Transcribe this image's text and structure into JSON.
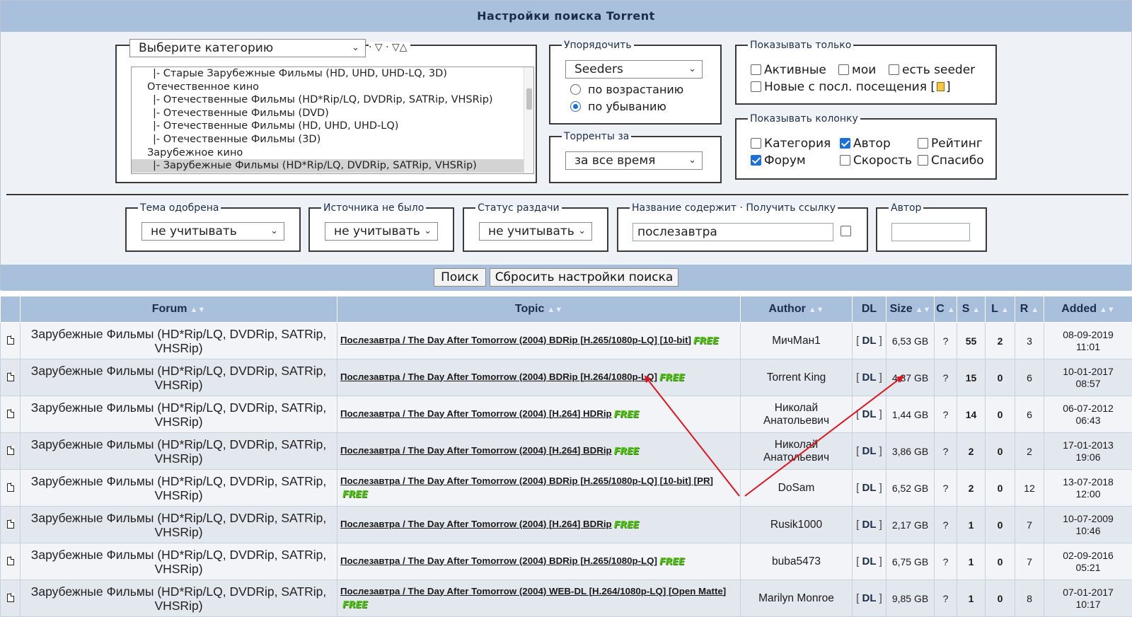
{
  "header": {
    "title": "Настройки поиска Torrent"
  },
  "category": {
    "select_value": "Выберите категорию",
    "extra_links": "· ▽ · ▽△",
    "list": [
      "|- Старые Зарубежные Фильмы (HD, UHD, UHD-LQ, 3D)",
      "Отечественное кино",
      "|- Отечественные Фильмы (HD*Rip/LQ, DVDRip, SATRip, VHSRip)",
      "|- Отечественные Фильмы (DVD)",
      "|- Отечественные Фильмы (HD, UHD, UHD-LQ)",
      "|- Отечественные Фильмы (3D)",
      "Зарубежное кино",
      "|- Зарубежные Фильмы (HD*Rip/LQ, DVDRip, SATRip, VHSRip)"
    ],
    "selected_index": 7
  },
  "order": {
    "legend": "Упорядочить",
    "sort_by": "Seeders",
    "asc_label": "по возрастанию",
    "desc_label": "по убыванию",
    "selected": "desc"
  },
  "period": {
    "legend": "Торренты за",
    "value": "за все время"
  },
  "show_only": {
    "legend": "Показывать только",
    "active": "Активные",
    "mine": "мои",
    "has_seeder": "есть seeder",
    "new_since": "Новые с посл. посещения [",
    "new_since_end": "]"
  },
  "show_column": {
    "legend": "Показывать колонку",
    "category": "Категория",
    "author": "Автор",
    "rating": "Рейтинг",
    "forum": "Форум",
    "speed": "Скорость",
    "thanks": "Спасибо"
  },
  "filters": {
    "approved": {
      "legend": "Тема одобрена",
      "value": "не учитывать"
    },
    "no_source": {
      "legend": "Источника не было",
      "value": "не учитывать"
    },
    "status": {
      "legend": "Статус раздачи",
      "value": "не учитывать"
    },
    "title_contains": {
      "legend": "Название содержит",
      "link": "· Получить ссылку",
      "value": "послезавтра"
    },
    "author": {
      "legend": "Автор",
      "value": ""
    }
  },
  "buttons": {
    "search": "Поиск",
    "reset": "Сбросить настройки поиска"
  },
  "table": {
    "headers": {
      "forum": "Forum",
      "topic": "Topic",
      "author": "Author",
      "dl": "DL",
      "size": "Size",
      "c": "C",
      "s": "S",
      "l": "L",
      "r": "R",
      "added": "Added"
    },
    "free_label": "FREE",
    "rows": [
      {
        "forum": "Зарубежные Фильмы (HD*Rip/LQ, DVDRip, SATRip, VHSRip)",
        "topic": "Послезавтра / The Day After Tomorrow (2004) BDRip [H.265/1080p-LQ] [10-bit]",
        "author": "МичМан1",
        "dl": "DL",
        "size": "6,53 GB",
        "c": "?",
        "s": "55",
        "l": "2",
        "r": "3",
        "added_date": "08-09-2019",
        "added_time": "11:01"
      },
      {
        "forum": "Зарубежные Фильмы (HD*Rip/LQ, DVDRip, SATRip, VHSRip)",
        "topic": "Послезавтра / The Day After Tomorrow (2004) BDRip [H.264/1080p-LQ]",
        "author": "Torrent King",
        "dl": "DL",
        "size": "4,37 GB",
        "c": "?",
        "s": "15",
        "l": "0",
        "r": "6",
        "added_date": "10-01-2017",
        "added_time": "08:57"
      },
      {
        "forum": "Зарубежные Фильмы (HD*Rip/LQ, DVDRip, SATRip, VHSRip)",
        "topic": "Послезавтра / The Day After Tomorrow (2004) [H.264] HDRip",
        "author": "Николай Анатольевич",
        "dl": "DL",
        "size": "1,44 GB",
        "c": "?",
        "s": "14",
        "l": "0",
        "r": "6",
        "added_date": "06-07-2012",
        "added_time": "06:43"
      },
      {
        "forum": "Зарубежные Фильмы (HD*Rip/LQ, DVDRip, SATRip, VHSRip)",
        "topic": "Послезавтра / The Day After Tomorrow (2004) [H.264] BDRip",
        "author": "Николай Анатольевич",
        "dl": "DL",
        "size": "3,86 GB",
        "c": "?",
        "s": "2",
        "l": "0",
        "r": "2",
        "added_date": "17-01-2013",
        "added_time": "19:06"
      },
      {
        "forum": "Зарубежные Фильмы (HD*Rip/LQ, DVDRip, SATRip, VHSRip)",
        "topic": "Послезавтра / The Day After Tomorrow (2004) BDRip [H.265/1080p-LQ] [10-bit] [PR]",
        "author": "DoSam",
        "dl": "DL",
        "size": "6,52 GB",
        "c": "?",
        "s": "2",
        "l": "0",
        "r": "12",
        "added_date": "13-07-2018",
        "added_time": "12:00"
      },
      {
        "forum": "Зарубежные Фильмы (HD*Rip/LQ, DVDRip, SATRip, VHSRip)",
        "topic": "Послезавтра / The Day After Tomorrow (2004) [H.264] BDRip",
        "author": "Rusik1000",
        "dl": "DL",
        "size": "2,17 GB",
        "c": "?",
        "s": "1",
        "l": "0",
        "r": "7",
        "added_date": "10-07-2009",
        "added_time": "10:46"
      },
      {
        "forum": "Зарубежные Фильмы (HD*Rip/LQ, DVDRip, SATRip, VHSRip)",
        "topic": "Послезавтра / The Day After Tomorrow (2004) BDRip [H.265/1080p-LQ]",
        "author": "buba5473",
        "dl": "DL",
        "size": "6,75 GB",
        "c": "?",
        "s": "1",
        "l": "0",
        "r": "7",
        "added_date": "02-09-2016",
        "added_time": "05:21"
      },
      {
        "forum": "Зарубежные Фильмы (HD*Rip/LQ, DVDRip, SATRip, VHSRip)",
        "topic": "Послезавтра / The Day After Tomorrow (2004) WEB-DL [H.264/1080p-LQ] [Open Matte]",
        "author": "Marilyn Monroe",
        "dl": "DL",
        "size": "9,85 GB",
        "c": "?",
        "s": "1",
        "l": "0",
        "r": "8",
        "added_date": "07-01-2017",
        "added_time": "10:17"
      }
    ]
  },
  "annotation_color": "#e0141e"
}
